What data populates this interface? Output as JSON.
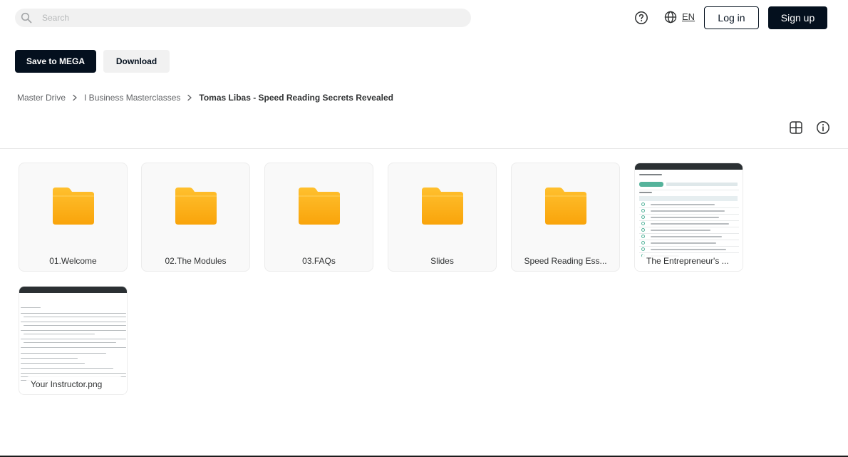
{
  "header": {
    "search_placeholder": "Search",
    "language": "EN",
    "login_label": "Log in",
    "signup_label": "Sign up"
  },
  "actions": {
    "save_label": "Save to MEGA",
    "download_label": "Download"
  },
  "breadcrumb": {
    "items": [
      "Master Drive",
      "I Business Masterclasses",
      "Tomas Libas - Speed Reading Secrets Revealed"
    ]
  },
  "items": [
    {
      "name": "01.Welcome",
      "type": "folder"
    },
    {
      "name": "02.The Modules",
      "type": "folder"
    },
    {
      "name": "03.FAQs",
      "type": "folder"
    },
    {
      "name": "Slides",
      "type": "folder"
    },
    {
      "name": "Speed Reading Ess...",
      "type": "folder"
    },
    {
      "name": "The Entrepreneur's ...",
      "type": "image"
    },
    {
      "name": "Your Instructor.png",
      "type": "image"
    }
  ],
  "colors": {
    "primary": "#04101e",
    "folder_top": "#ffc02e",
    "folder_bottom": "#f9a40b",
    "surface": "#f1f1f1"
  }
}
